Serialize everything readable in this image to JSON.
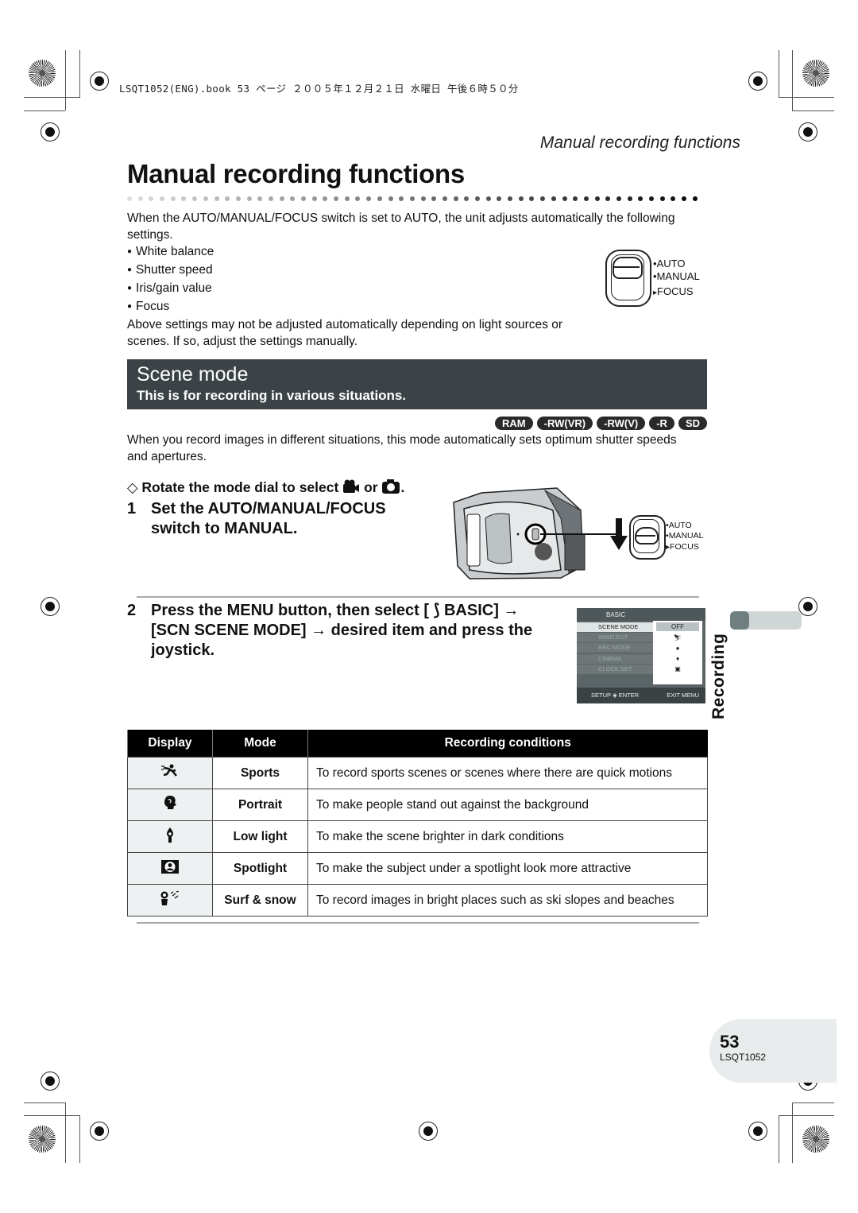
{
  "print_header": "LSQT1052(ENG).book  53 ページ  ２００５年１２月２１日  水曜日  午後６時５０分",
  "running_head": "Manual recording functions",
  "page_title": "Manual recording functions",
  "intro": {
    "paragraph": "When the AUTO/MANUAL/FOCUS switch is set to AUTO, the unit adjusts automatically the following settings.",
    "bullets": [
      "White balance",
      "Shutter speed",
      "Iris/gain value",
      "Focus"
    ],
    "note": "Above settings may not be adjusted automatically depending on light sources or scenes. If so, adjust the settings manually."
  },
  "switch_labels": {
    "auto": "AUTO",
    "manual": "MANUAL",
    "focus": "FOCUS"
  },
  "section": {
    "title": "Scene mode",
    "subtitle": "This is for recording in various situations."
  },
  "media_badges": [
    "RAM",
    "-RW(VR)",
    "-RW(V)",
    "-R",
    "SD"
  ],
  "section_paragraph": "When you record images in different situations, this mode automatically sets optimum shutter speeds and apertures.",
  "steps": {
    "prep": {
      "prefix": "◇",
      "text": "Rotate the mode dial to select",
      "or": "or",
      "end": "."
    },
    "step1": {
      "num": "1",
      "line1": "Set the AUTO/MANUAL/FOCUS",
      "line2": "switch to MANUAL."
    },
    "step2": {
      "num": "2",
      "line1": "Press the MENU button, then select [ ⟆ BASIC] →",
      "line2": "[SCN SCENE MODE] → desired item and press the",
      "line3": "joystick."
    }
  },
  "menu_screen": {
    "header": "BASIC",
    "items": [
      "SCENE MODE",
      "WIND CUT",
      "REC MODE",
      "CINEMA",
      "CLOCK SET"
    ],
    "selected_value": "OFF",
    "footer_left": "SETUP ◈ ENTER",
    "footer_right": "EXIT MENU"
  },
  "side_tab": "Recording",
  "table": {
    "headers": [
      "Display",
      "Mode",
      "Recording conditions"
    ],
    "rows": [
      {
        "icon": "sports-icon",
        "mode": "Sports",
        "condition": "To record sports scenes or scenes where there are quick motions"
      },
      {
        "icon": "portrait-icon",
        "mode": "Portrait",
        "condition": "To make people stand out against the background"
      },
      {
        "icon": "low-light-icon",
        "mode": "Low light",
        "condition": "To make the scene brighter in dark conditions"
      },
      {
        "icon": "spotlight-icon",
        "mode": "Spotlight",
        "condition": "To make the subject under a spotlight look more attractive"
      },
      {
        "icon": "surf-snow-icon",
        "mode": "Surf & snow",
        "condition": "To record images in bright places such as ski slopes and beaches"
      }
    ]
  },
  "footer": {
    "page_number": "53",
    "code": "LSQT1052"
  }
}
